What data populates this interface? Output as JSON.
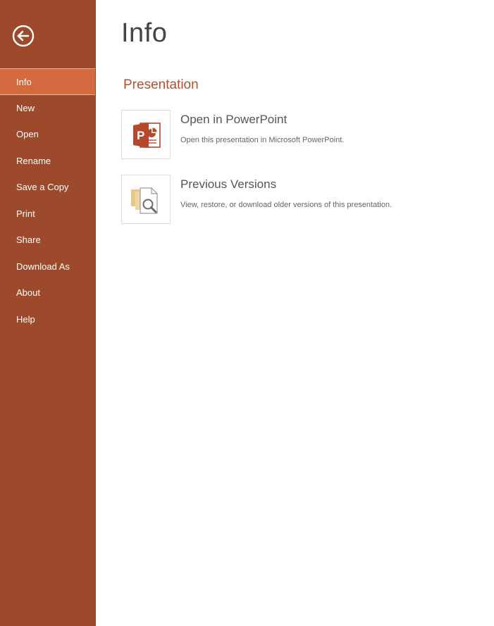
{
  "sidebar": {
    "back_icon": "back-arrow-circle-icon",
    "items": [
      {
        "label": "Info",
        "active": true
      },
      {
        "label": "New"
      },
      {
        "label": "Open"
      },
      {
        "label": "Rename"
      },
      {
        "label": "Save a Copy"
      },
      {
        "label": "Print"
      },
      {
        "label": "Share"
      },
      {
        "label": "Download As"
      },
      {
        "label": "About"
      },
      {
        "label": "Help"
      }
    ]
  },
  "main": {
    "title": "Info",
    "section_title": "Presentation",
    "options": [
      {
        "icon": "powerpoint-icon",
        "title": "Open in PowerPoint",
        "description": "Open this presentation in Microsoft PowerPoint."
      },
      {
        "icon": "previous-versions-icon",
        "title": "Previous Versions",
        "description": "View, restore, or download older versions of this presentation."
      }
    ]
  },
  "colors": {
    "sidebar_bg": "#9c4a2b",
    "sidebar_active": "#d36a40",
    "accent": "#b3502f"
  }
}
